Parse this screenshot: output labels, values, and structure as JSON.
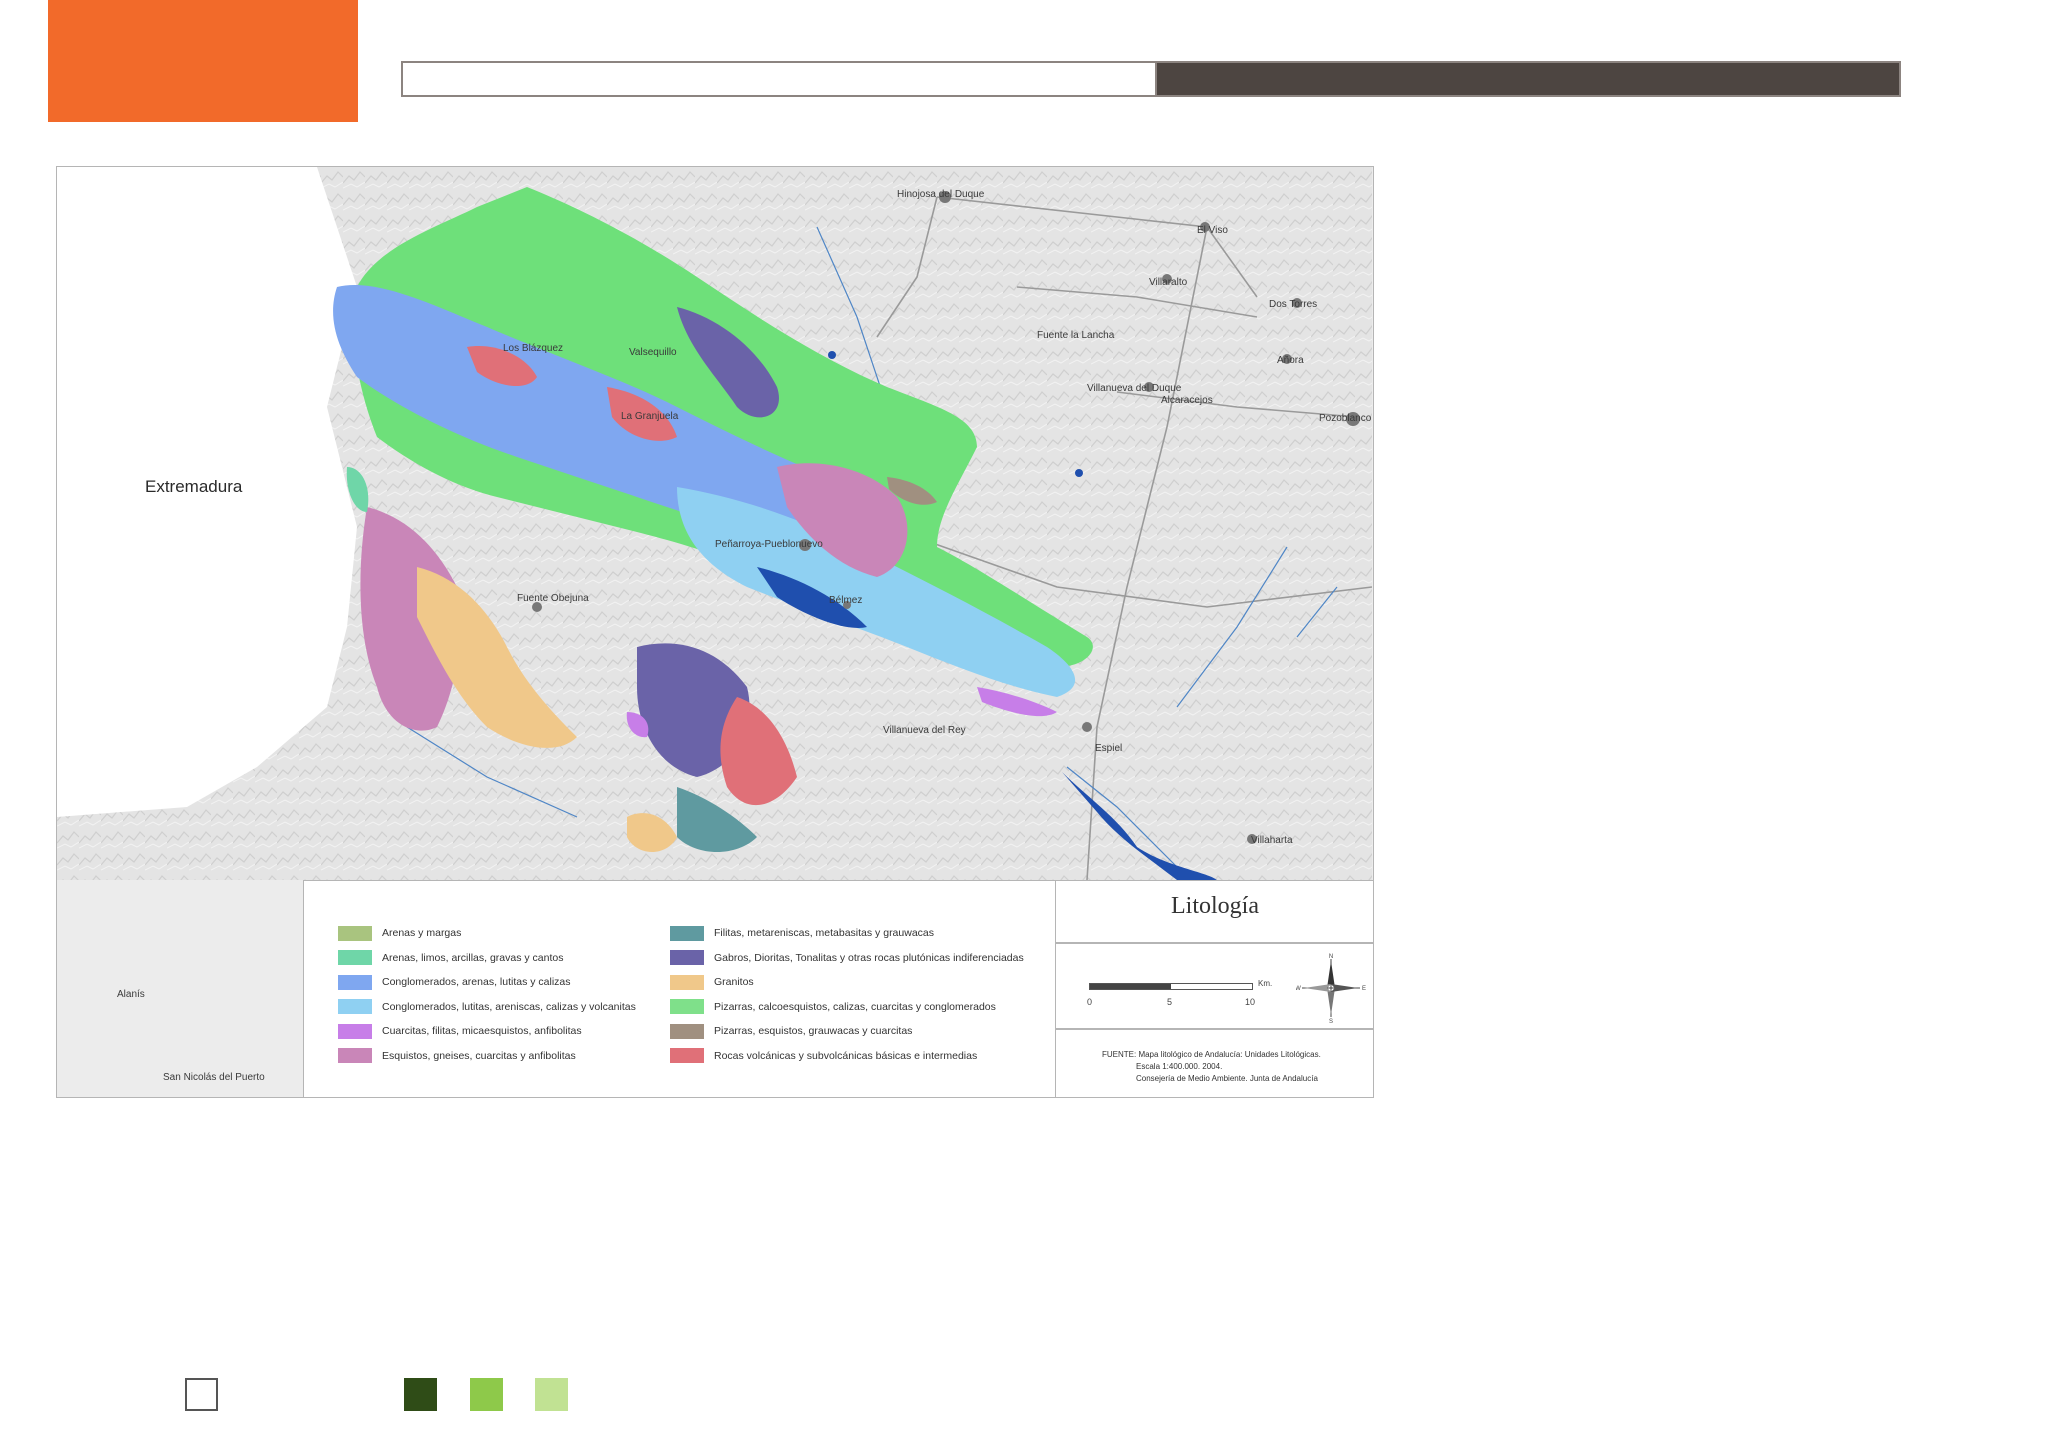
{
  "header": {
    "accent_color": "#f26a2a",
    "bar_dark_color": "#4d4541"
  },
  "map": {
    "region_label": "Extremadura",
    "towns": [
      "Hinojosa del Duque",
      "El Viso",
      "Villaralto",
      "Dos Torres",
      "Fuente la Lancha",
      "Añora",
      "Villanueva del Duque",
      "Alcaracejos",
      "Pozoblanco",
      "Los Blázquez",
      "Valsequillo",
      "La Granjuela",
      "Peñarroya-Pueblonuevo",
      "Bélmez",
      "Fuente Obejuna",
      "Villanueva del Rey",
      "Espiel",
      "Villaharta",
      "Alanís",
      "San Nicolás del Puerto"
    ]
  },
  "legend": {
    "left_column": [
      {
        "label": "Arenas y margas",
        "color": "#a9c47f"
      },
      {
        "label": "Arenas, limos, arcillas, gravas y cantos",
        "color": "#6fd6a8"
      },
      {
        "label": "Conglomerados, arenas, lutitas y calizas",
        "color": "#7fa7f0"
      },
      {
        "label": "Conglomerados, lutitas, areniscas, calizas y volcanitas",
        "color": "#8fd0f2"
      },
      {
        "label": "Cuarcitas, filitas, micaesquistos, anfibolitas",
        "color": "#c77ee8"
      },
      {
        "label": "Esquistos, gneises, cuarcitas y anfibolitas",
        "color": "#c986b8"
      }
    ],
    "right_column": [
      {
        "label": "Filitas, metareniscas, metabasitas y grauwacas",
        "color": "#5f9aa0"
      },
      {
        "label": "Gabros, Dioritas, Tonalitas y otras rocas plutónicas indiferenciadas",
        "color": "#6a63a8"
      },
      {
        "label": "Granitos",
        "color": "#f0c88a"
      },
      {
        "label": "Pizarras, calcoesquistos, calizas, cuarcitas y conglomerados",
        "color": "#7fe08a"
      },
      {
        "label": "Pizarras, esquistos, grauwacas y cuarcitas",
        "color": "#a09080"
      },
      {
        "label": "Rocas volcánicas y subvolcánicas básicas e intermedias",
        "color": "#e07078"
      }
    ]
  },
  "map_info": {
    "title": "Litología",
    "scale_ticks": [
      "0",
      "5",
      "10"
    ],
    "scale_unit": "Km.",
    "compass": {
      "n": "N",
      "s": "S",
      "e": "E",
      "w": "W"
    },
    "source_lines": [
      "FUENTE: Mapa litológico de Andalucía: Unidades Litológicas.",
      "Escala 1:400.000. 2004.",
      "Consejería de Medio Ambiente. Junta de Andalucía"
    ]
  },
  "footer_swatches": [
    "#2f4c17",
    "#8ec94a",
    "#c1e293"
  ]
}
